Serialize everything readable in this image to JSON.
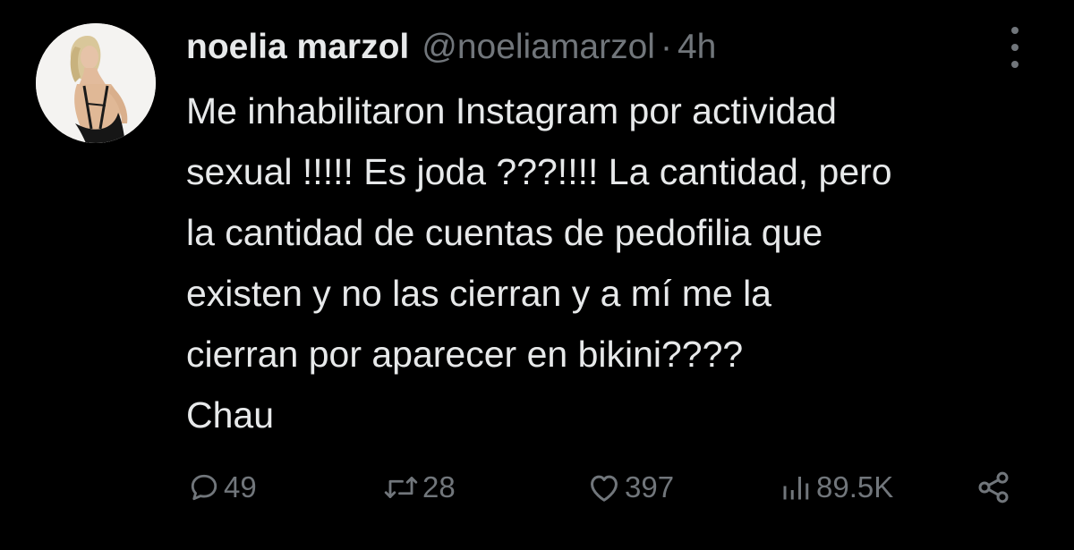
{
  "tweet": {
    "author": {
      "name": "noelia marzol",
      "handle": "@noeliamarzol",
      "avatar": "profile-photo"
    },
    "separator": "·",
    "time": "4h",
    "text_lines": [
      "Me inhabilitaron Instagram por actividad",
      "sexual !!!!! Es joda ???!!!! La cantidad, pero",
      "la cantidad de cuentas de pedofilia que",
      "existen y no las cierran y a mí me la",
      "cierran por aparecer en bikini????",
      "Chau"
    ],
    "stats": {
      "replies": "49",
      "reposts": "28",
      "likes": "397",
      "views": "89.5K"
    }
  },
  "icons": {
    "reply": "reply-bubble-icon",
    "repost": "repost-arrows-icon",
    "like": "heart-icon",
    "views": "bar-chart-icon",
    "share": "share-nodes-icon",
    "more": "vertical-ellipsis-icon"
  },
  "colors": {
    "background": "#000000",
    "text": "#e7e9ea",
    "secondary": "#71767b"
  }
}
